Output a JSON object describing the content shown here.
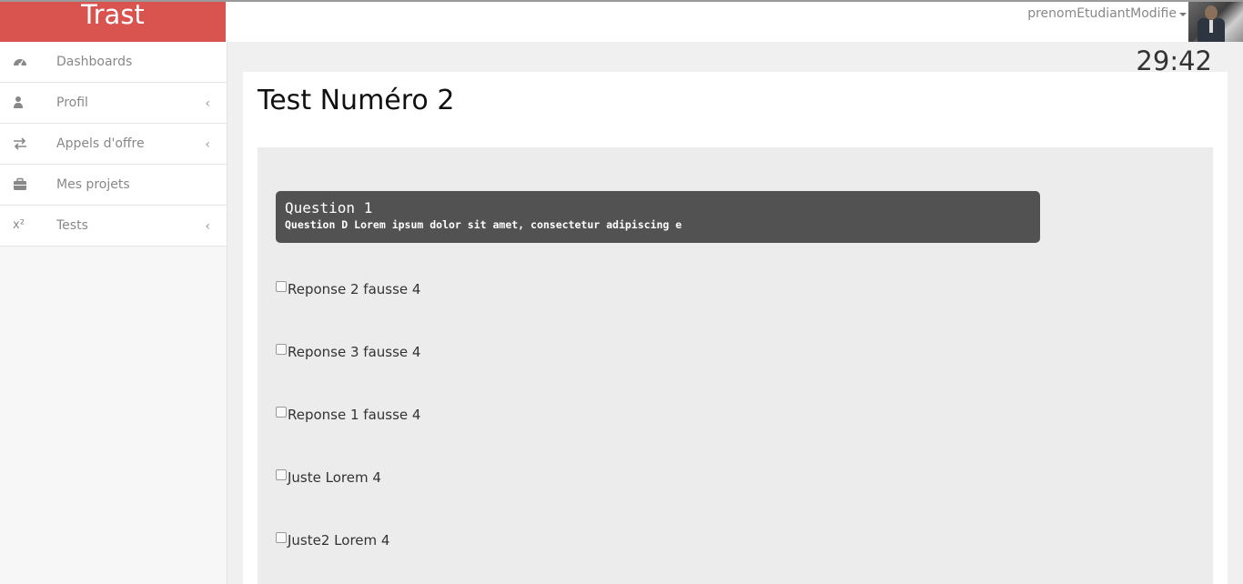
{
  "brand": {
    "name": "Trast"
  },
  "header": {
    "username": "prenomEtudiantModifie"
  },
  "sidebar": {
    "items": [
      {
        "label": "Dashboards",
        "icon": "dashboard-icon",
        "has_chevron": false
      },
      {
        "label": "Profil",
        "icon": "user-icon",
        "has_chevron": true
      },
      {
        "label": "Appels d'offre",
        "icon": "exchange-icon",
        "has_chevron": true
      },
      {
        "label": "Mes projets",
        "icon": "briefcase-icon",
        "has_chevron": false
      },
      {
        "label": "Tests",
        "icon": "superscript-icon",
        "has_chevron": true
      }
    ]
  },
  "main": {
    "timer": "29:42",
    "title": "Test Numéro 2",
    "question": {
      "title": "Question 1",
      "text": "Question D Lorem ipsum dolor sit amet, consectetur adipiscing e"
    },
    "answers": [
      {
        "label": "Reponse 2 fausse 4",
        "checked": false
      },
      {
        "label": "Reponse 3 fausse 4",
        "checked": false
      },
      {
        "label": "Reponse 1 fausse 4",
        "checked": false
      },
      {
        "label": "Juste Lorem 4",
        "checked": false
      },
      {
        "label": "Juste2 Lorem 4",
        "checked": false
      }
    ]
  },
  "colors": {
    "brand": "#d9534f",
    "question_box": "#525252",
    "quiz_area": "#ececec",
    "sidebar_text": "#888888"
  }
}
